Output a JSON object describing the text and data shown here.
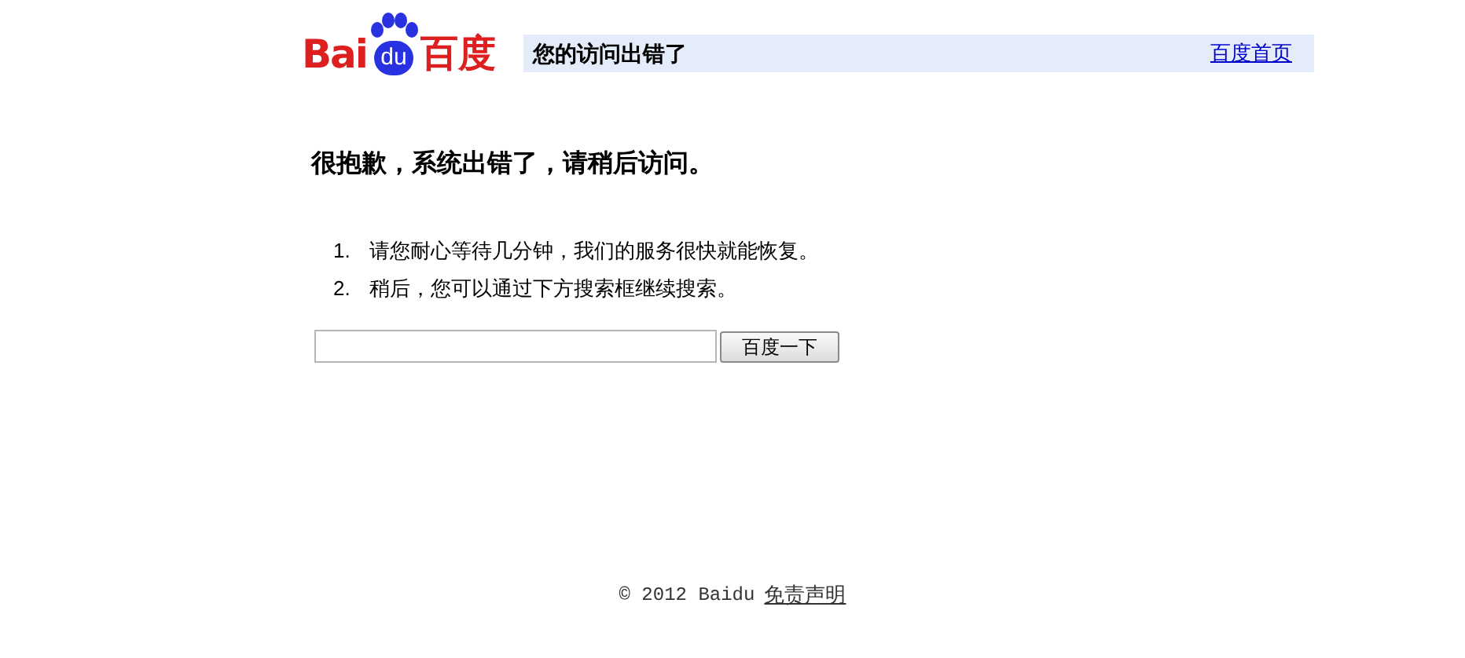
{
  "header": {
    "logo": {
      "left": "Bai",
      "paw": "du",
      "right": "百度"
    },
    "title": "您的访问出错了",
    "home_link": "百度首页"
  },
  "message": "很抱歉，系统出错了，请稍后访问。",
  "tips": [
    {
      "number": "1.",
      "text": "请您耐心等待几分钟，我们的服务很快就能恢复。"
    },
    {
      "number": "2.",
      "text": "稍后，您可以通过下方搜索框继续搜索。"
    }
  ],
  "search": {
    "button": "百度一下"
  },
  "footer": {
    "copyright": "© 2012 Baidu",
    "link": "免责声明"
  }
}
